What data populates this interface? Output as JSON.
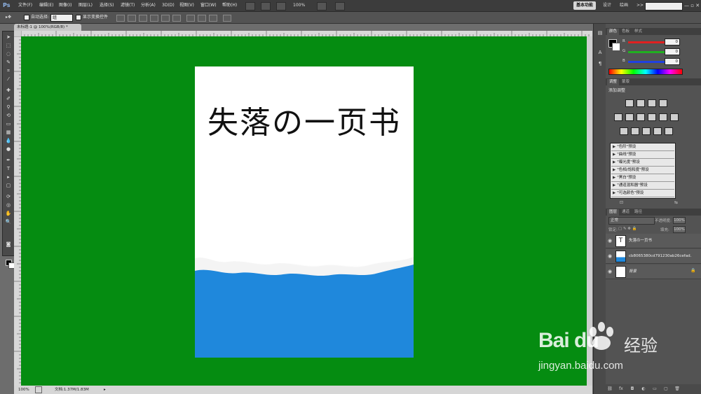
{
  "menubar": {
    "logo": "Ps",
    "items": [
      "文件(F)",
      "编辑(E)",
      "图像(I)",
      "图层(L)",
      "选择(S)",
      "滤镜(T)",
      "分析(A)",
      "3D(D)",
      "视图(V)",
      "窗口(W)",
      "帮助(H)"
    ],
    "zoom": "100%",
    "workspaces": [
      "基本功能",
      "设计",
      "绘画",
      "摄影"
    ],
    "more": ">>"
  },
  "options": {
    "auto_select": "自动选择:",
    "group_value": "组",
    "show_transform": "显示变换控件"
  },
  "document": {
    "tab_label": "未标题-1 @ 100%(RGB/8) *",
    "title_text": "失落の一页书",
    "canvas_color": "#058c11",
    "blue_color": "#1f88dc"
  },
  "statusbar": {
    "zoom": "100%",
    "doc_info": "文档:1.37M/1.83M"
  },
  "color_panel": {
    "tabs": [
      "颜色",
      "色板",
      "样式"
    ],
    "channels": [
      {
        "label": "R",
        "value": "0",
        "color": "#e02020"
      },
      {
        "label": "G",
        "value": "0",
        "color": "#20b020"
      },
      {
        "label": "B",
        "value": "0",
        "color": "#2040e0"
      }
    ]
  },
  "adjust_panel": {
    "tabs": [
      "调整",
      "蒙版"
    ],
    "label": "添加调整",
    "presets": [
      "\"色阶\"预设",
      "\"曲线\"预设",
      "\"曝光度\"预设",
      "\"色相/饱和度\"预设",
      "\"黑白\"预设",
      "\"通道混和器\"预设",
      "\"可选颜色\"预设"
    ]
  },
  "layers_panel": {
    "tabs": [
      "图层",
      "通道",
      "路径"
    ],
    "blend_mode": "正常",
    "opacity_label": "不透明度:",
    "opacity": "100%",
    "lock_label": "锁定:",
    "fill_label": "填充:",
    "fill": "100%",
    "layers": [
      {
        "name": "失落の一页书",
        "thumb": "T"
      },
      {
        "name": "cb8065380cd791230ab26cefad...",
        "thumb": ""
      },
      {
        "name": "背景",
        "thumb": ""
      }
    ]
  },
  "watermark": {
    "logo": "Bai du",
    "cn": "经验",
    "url": "jingyan.baidu.com"
  }
}
